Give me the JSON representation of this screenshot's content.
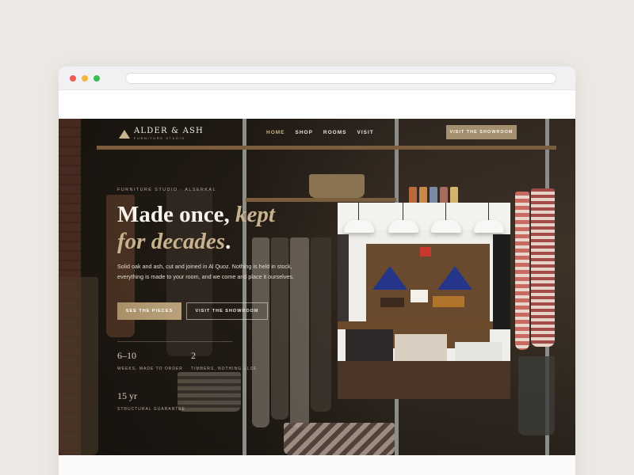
{
  "brand": {
    "name": "ALDER & ASH",
    "subtitle": "FURNITURE STUDIO"
  },
  "nav": {
    "items": [
      "HOME",
      "SHOP",
      "ROOMS",
      "VISIT"
    ],
    "active": "HOME",
    "cta": "VISIT THE SHOWROOM"
  },
  "hero": {
    "eyebrow": "FURNITURE STUDIO · ALSERKAL",
    "headline_line1": "Made once,",
    "headline_em1": "kept",
    "headline_em2": "for decades",
    "headline_end": ".",
    "lede": "Solid oak and ash, cut and joined in Al Quoz. Nothing is held in stock, everything is made to your room, and we come and place it ourselves.",
    "primary_cta": "SEE THE PIECES",
    "secondary_cta": "VISIT THE SHOWROOM"
  },
  "stats": [
    {
      "value": "6–10",
      "label": "WEEKS, MADE TO ORDER"
    },
    {
      "value": "2",
      "label": "TIMBERS, NOTHING ELSE"
    },
    {
      "value": "15 yr",
      "label": "STRUCTURAL GUARANTEE"
    }
  ],
  "colors": {
    "accent": "#c9b48e",
    "button": "#a48f6e",
    "page_bg": "#ece9e5"
  }
}
